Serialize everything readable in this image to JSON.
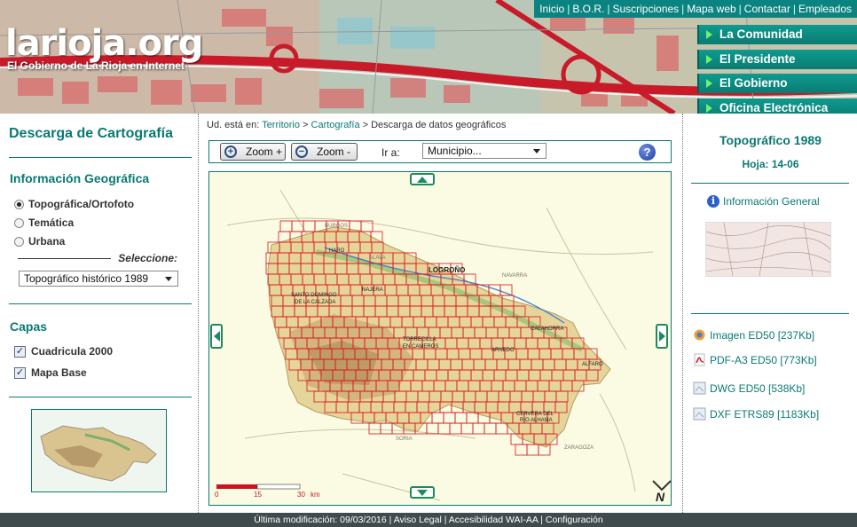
{
  "top_links": [
    "Inicio",
    "B.O.R.",
    "Suscripciones",
    "Mapa web",
    "Contactar",
    "Empleados"
  ],
  "logo": {
    "text": "larioja.org",
    "subtitle": "El Gobierno de La Rioja en Internet"
  },
  "main_nav": [
    "La Comunidad",
    "El Presidente",
    "El Gobierno",
    "Oficina Electrónica"
  ],
  "left": {
    "title": "Descarga de Cartografía",
    "info_section": "Información Geográfica",
    "radios": [
      {
        "label": "Topográfica/Ortofoto",
        "checked": true
      },
      {
        "label": "Temática",
        "checked": false
      },
      {
        "label": "Urbana",
        "checked": false
      }
    ],
    "select_label": "Seleccione:",
    "select_value": "Topográfico histórico 1989",
    "layers_section": "Capas",
    "layers": [
      {
        "label": "Cuadricula 2000",
        "checked": true
      },
      {
        "label": "Mapa Base",
        "checked": true
      }
    ]
  },
  "breadcrumb": {
    "prefix": "Ud. está en:",
    "items": [
      "Territorio",
      "Cartografía"
    ],
    "current": "Descarga de datos geográficos"
  },
  "toolbar": {
    "zoom_in": "Zoom +",
    "zoom_out": "Zoom -",
    "goto_label": "Ir a:",
    "goto_value": "Municipio...",
    "help_icon": "help-icon"
  },
  "map": {
    "labels": {
      "burgos": "BURGOS",
      "haro": "HARO",
      "alava": "ALAVA",
      "logrono": "LOGROÑO",
      "navarra": "NAVARRA",
      "nájera": "NAJERA",
      "santo_domingo_1": "SANTO DOMINGO",
      "santo_domingo_2": "DE LA CALZADA",
      "torrecilla_1": "TORRECILLA",
      "torrecilla_2": "EN CAMEROS",
      "calahorra": "CALAHORRA",
      "arnedo": "ARNEDO",
      "alfaro": "ALFARO",
      "cervera_1": "CERVERA DEL",
      "cervera_2": "RIO ALHAMA",
      "soria": "SORIA",
      "zaragoza": "ZARAGOZA"
    },
    "scale_labels": [
      "0",
      "15",
      "30",
      "km"
    ],
    "north_label": "N",
    "grid_color": "#d8141c"
  },
  "right": {
    "sheet_title": "Topográfico 1989",
    "sheet_no": "Hoja: 14-06",
    "info_general": "Información General",
    "downloads": [
      {
        "label": "Imagen ED50 [237Kb]",
        "icon": "image-icon"
      },
      {
        "label": "PDF-A3 ED50 [773Kb]",
        "icon": "pdf-icon"
      },
      {
        "label": "DWG ED50 [538Kb]",
        "icon": "dwg-file-icon"
      },
      {
        "label": "DXF ETRS89 [1183Kb]",
        "icon": "dxf-file-icon"
      }
    ]
  },
  "footer": "Última modificación: 09/03/2016 | Aviso Legal | Accesibilidad WAI-AA | Configuración",
  "colors": {
    "brand": "#0a7a72",
    "nav": "#0f9a8e",
    "footer": "#3f4b4d"
  }
}
